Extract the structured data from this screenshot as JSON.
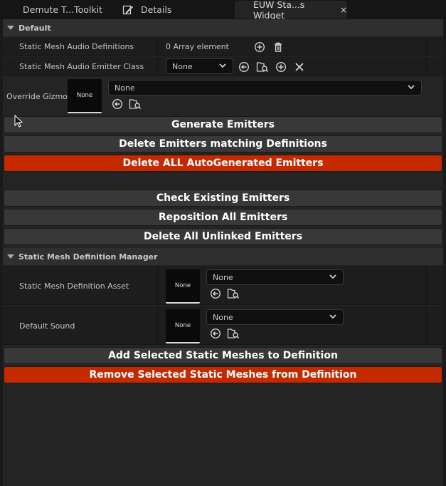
{
  "tabs": [
    {
      "label": "Demute T...Toolkit"
    },
    {
      "label": "Details"
    },
    {
      "label": "EUW Sta...s Widget",
      "close": "×"
    }
  ],
  "sections": {
    "default": {
      "title": "Default"
    },
    "manager": {
      "title": "Static Mesh Definition Manager"
    }
  },
  "properties": {
    "audio_definitions": {
      "label": "Static Mesh Audio Definitions",
      "value": "0 Array element"
    },
    "emitter_class": {
      "label": "Static Mesh Audio Emitter Class",
      "value": "None"
    },
    "override_gizmo": {
      "label": "Override Gizmo",
      "thumb": "None",
      "value": "None"
    },
    "definition_asset": {
      "label": "Static Mesh Definition Asset",
      "thumb": "None",
      "value": "None"
    },
    "default_sound": {
      "label": "Default Sound",
      "thumb": "None",
      "value": "None"
    }
  },
  "buttons": {
    "generate": "Generate Emitters",
    "delete_matching": "Delete Emitters matching Definitions",
    "delete_all_auto": "Delete ALL AutoGenerated Emitters",
    "check_existing": "Check Existing Emitters",
    "reposition_all": "Reposition All Emitters",
    "delete_unlinked": "Delete All Unlinked Emitters",
    "add_selected": "Add Selected Static Meshes to Definition",
    "remove_selected": "Remove Selected Static Meshes from Definition"
  },
  "colors": {
    "danger": "#c42900",
    "button": "#383838",
    "panel": "#242424"
  },
  "icons": [
    "edit-icon",
    "add-icon",
    "trash-icon",
    "reset-arrow-icon",
    "browse-icon",
    "clear-icon",
    "chevron-down-icon",
    "collapse-arrow-icon",
    "mouse-cursor-icon"
  ]
}
